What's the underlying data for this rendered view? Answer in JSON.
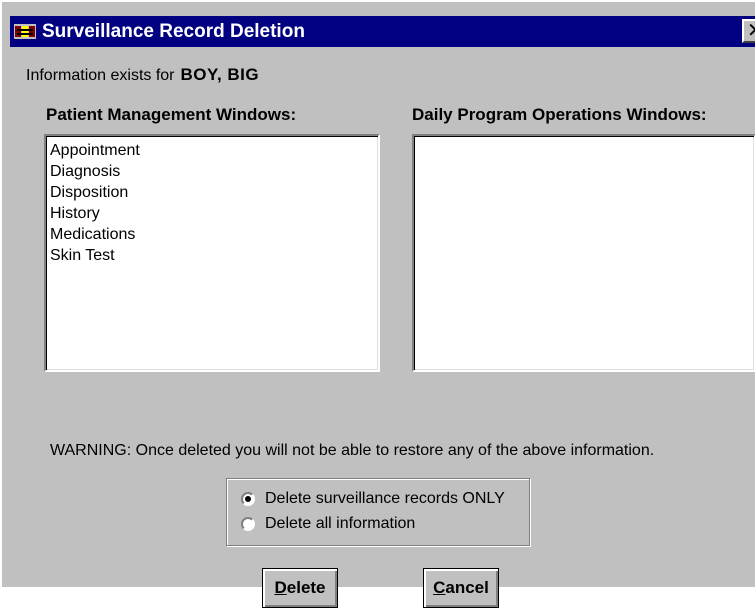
{
  "window": {
    "title": "Surveillance Record Deletion",
    "close_glyph": "✕"
  },
  "info": {
    "prefix": "Information exists for",
    "name": "BOY, BIG"
  },
  "lists": {
    "patient_management": {
      "heading": "Patient Management Windows:",
      "items": [
        "Appointment",
        "Diagnosis",
        "Disposition",
        "History",
        "Medications",
        "Skin Test"
      ]
    },
    "daily_program": {
      "heading": "Daily Program Operations Windows:",
      "items": []
    }
  },
  "warning": "WARNING:  Once deleted you will not be able to restore any of the above information.",
  "options": [
    {
      "label": "Delete surveillance records ONLY",
      "checked": true
    },
    {
      "label": "Delete all information",
      "checked": false
    }
  ],
  "buttons": {
    "delete": {
      "mnemonic": "D",
      "rest": "elete"
    },
    "cancel": {
      "mnemonic": "C",
      "rest": "ancel"
    }
  },
  "colors": {
    "titlebar": "#000080",
    "face": "#c0c0c0"
  }
}
